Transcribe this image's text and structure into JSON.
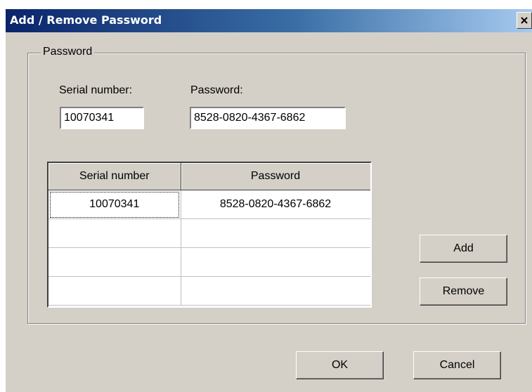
{
  "window": {
    "title": "Add / Remove Password",
    "close_glyph": "X"
  },
  "group": {
    "legend": "Password"
  },
  "form": {
    "serial_label": "Serial number:",
    "serial_value": "10070341",
    "password_label": "Password:",
    "password_value": "8528-0820-4367-6862"
  },
  "table": {
    "columns": [
      "Serial number",
      "Password"
    ],
    "rows": [
      [
        "10070341",
        "8528-0820-4367-6862"
      ],
      [
        "",
        ""
      ],
      [
        "",
        ""
      ],
      [
        "",
        ""
      ]
    ]
  },
  "buttons": {
    "add": "Add",
    "remove": "Remove",
    "ok": "OK",
    "cancel": "Cancel"
  },
  "colors": {
    "titlebar_start": "#0a246a",
    "titlebar_end": "#a6caf0",
    "face": "#d4d0c8"
  },
  "icons": {
    "close": "close-icon"
  }
}
